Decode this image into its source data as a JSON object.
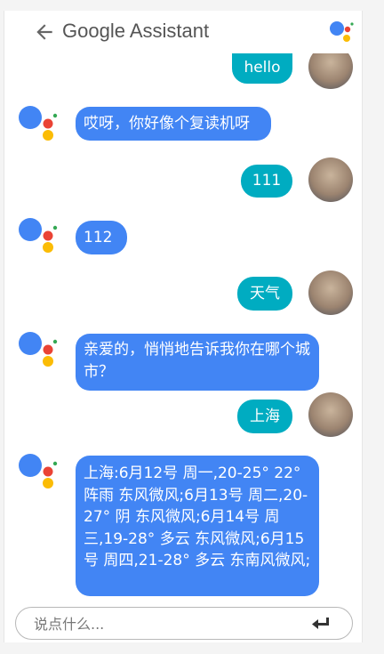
{
  "header": {
    "title": "Google Assistant",
    "back_icon": "arrow-back-icon",
    "logo_icon": "google-assistant-logo-icon"
  },
  "colors": {
    "user_bubble": "#00acc1",
    "bot_bubble": "#4285f4",
    "logo_blue": "#4285f4",
    "logo_red": "#ea4335",
    "logo_yellow": "#fbbc05",
    "logo_green": "#34a853"
  },
  "messages": [
    {
      "from": "user",
      "text": "hello"
    },
    {
      "from": "assistant",
      "text": "哎呀，你好像个复读机呀"
    },
    {
      "from": "user",
      "text": "111"
    },
    {
      "from": "assistant",
      "text": "112"
    },
    {
      "from": "user",
      "text": "天气"
    },
    {
      "from": "assistant",
      "text": "亲爱的，悄悄地告诉我你在哪个城市？"
    },
    {
      "from": "user",
      "text": "上海"
    },
    {
      "from": "assistant",
      "text": "上海:6月12号 周一,20-25° 22° 阵雨 东风微风;6月13号 周二,20-27° 阴 东风微风;6月14号 周三,19-28° 多云 东风微风;6月15号 周四,21-28° 多云 东南风微风;"
    }
  ],
  "composer": {
    "placeholder": "说点什么...",
    "send_icon": "enter-return-icon"
  }
}
